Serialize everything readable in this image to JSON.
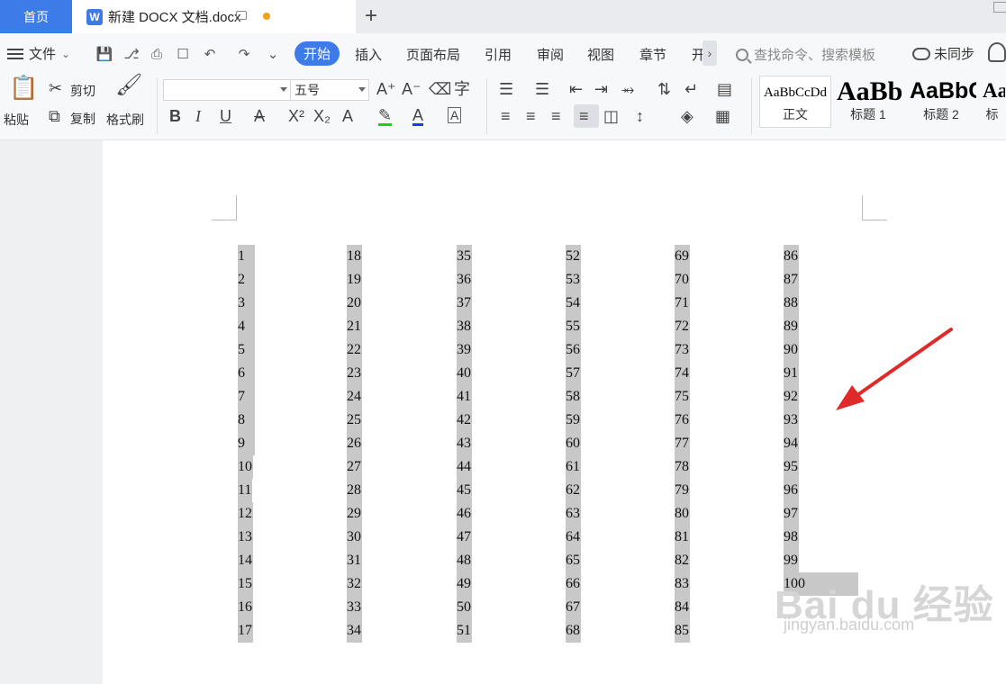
{
  "tabs": {
    "home": "首页",
    "document": "新建 DOCX 文档.docx",
    "doc_icon": "W"
  },
  "menu": {
    "file": "文件",
    "items": [
      "开始",
      "插入",
      "页面布局",
      "引用",
      "审阅",
      "视图",
      "章节",
      "开"
    ],
    "search_placeholder": "查找命令、搜索模板",
    "sync": "未同步"
  },
  "ribbon": {
    "paste": "粘贴",
    "cut": "剪切",
    "copy": "复制",
    "format_painter": "格式刷",
    "font_name": "",
    "font_size": "五号",
    "styles": [
      {
        "sample": "AaBbCcDd",
        "name": "正文"
      },
      {
        "sample": "AaBb",
        "name": "标题 1"
      },
      {
        "sample": "AaBbC",
        "name": "标题 2"
      },
      {
        "sample": "AaB",
        "name": "标"
      }
    ]
  },
  "document": {
    "columns": [
      [
        "1",
        "2",
        "3",
        "4",
        "5",
        "6",
        "7",
        "8",
        "9",
        "10",
        "11",
        "12",
        "13",
        "14",
        "15",
        "16",
        "17"
      ],
      [
        "18",
        "19",
        "20",
        "21",
        "22",
        "23",
        "24",
        "25",
        "26",
        "27",
        "28",
        "29",
        "30",
        "31",
        "32",
        "33",
        "34"
      ],
      [
        "35",
        "36",
        "37",
        "38",
        "39",
        "40",
        "41",
        "42",
        "43",
        "44",
        "45",
        "46",
        "47",
        "48",
        "49",
        "50",
        "51"
      ],
      [
        "52",
        "53",
        "54",
        "55",
        "56",
        "57",
        "58",
        "59",
        "60",
        "61",
        "62",
        "63",
        "64",
        "65",
        "66",
        "67",
        "68"
      ],
      [
        "69",
        "70",
        "71",
        "72",
        "73",
        "74",
        "75",
        "76",
        "77",
        "78",
        "79",
        "80",
        "81",
        "82",
        "83",
        "84",
        "85"
      ],
      [
        "86",
        "87",
        "88",
        "89",
        "90",
        "91",
        "92",
        "93",
        "94",
        "95",
        "96",
        "97",
        "98",
        "99",
        "100"
      ]
    ],
    "highlight_color": "#c8c8c8"
  },
  "watermark": {
    "main": "Bai du 经验",
    "sub": "jingyan.baidu.com"
  },
  "colors": {
    "accent": "#3d7be9",
    "annotation_arrow": "#e02a2a",
    "unsaved_dot": "#f0a31a"
  }
}
